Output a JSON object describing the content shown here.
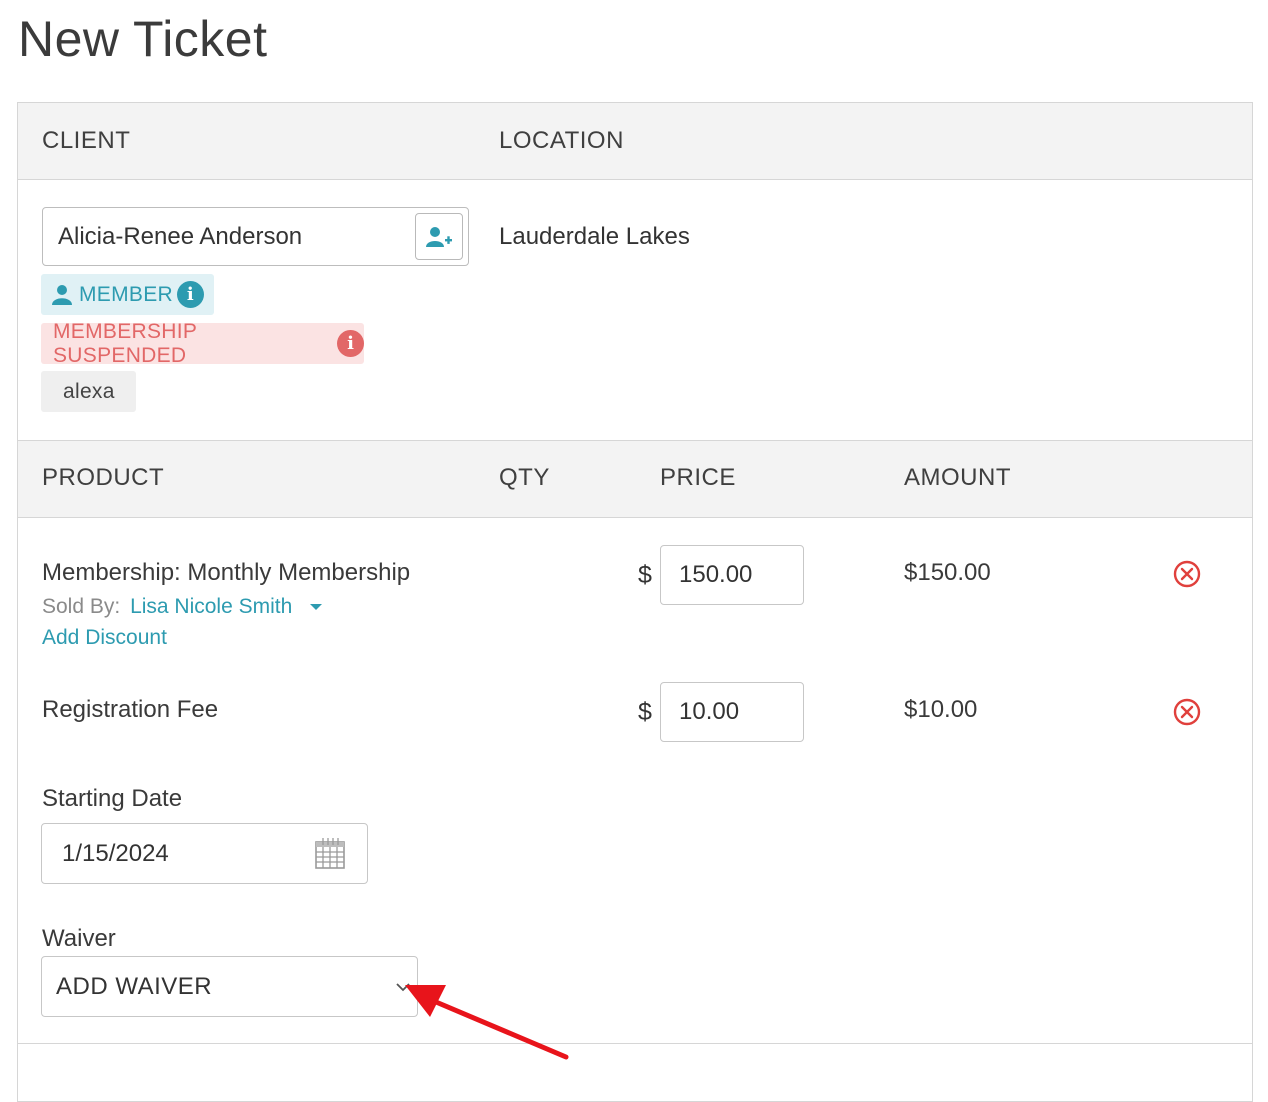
{
  "page": {
    "title": "New Ticket"
  },
  "client_section": {
    "client_header": "CLIENT",
    "location_header": "LOCATION",
    "client_name": "Alicia-Renee Anderson",
    "location": "Lauderdale Lakes",
    "badges": {
      "member": "MEMBER",
      "suspended": "MEMBERSHIP SUSPENDED",
      "tag": "alexa"
    }
  },
  "product_table": {
    "headers": {
      "product": "PRODUCT",
      "qty": "QTY",
      "price": "PRICE",
      "amount": "AMOUNT"
    },
    "currency_symbol": "$",
    "rows": [
      {
        "name": "Membership: Monthly Membership",
        "sold_by_label": "Sold By:",
        "sold_by": "Lisa Nicole Smith",
        "add_discount": "Add Discount",
        "price": "150.00",
        "amount": "$150.00"
      },
      {
        "name": "Registration Fee",
        "price": "10.00",
        "amount": "$10.00"
      }
    ]
  },
  "starting_date": {
    "label": "Starting Date",
    "value": "1/15/2024"
  },
  "waiver": {
    "label": "Waiver",
    "selected": "ADD WAIVER"
  },
  "colors": {
    "accent_teal": "#2d9bb0",
    "danger_red": "#e26767",
    "remove_red": "#e0403c",
    "annotation_arrow": "#e8141b"
  }
}
